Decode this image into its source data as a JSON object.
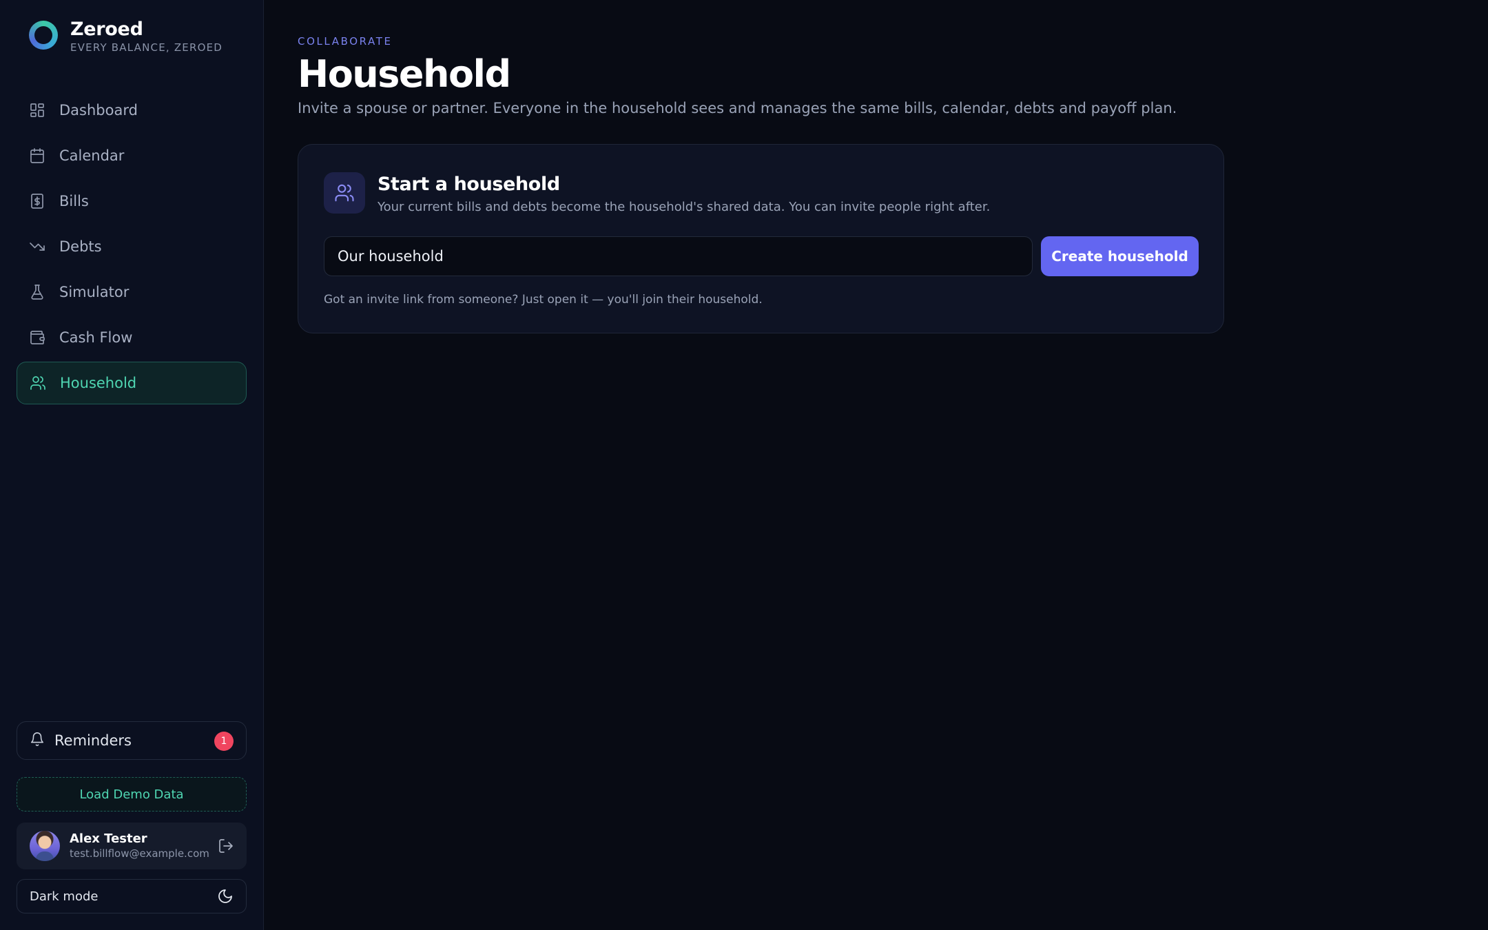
{
  "brand": {
    "name": "Zeroed",
    "tagline": "EVERY BALANCE, ZEROED"
  },
  "sidebar": {
    "items": [
      {
        "label": "Dashboard",
        "icon": "dashboard-icon",
        "active": false
      },
      {
        "label": "Calendar",
        "icon": "calendar-icon",
        "active": false
      },
      {
        "label": "Bills",
        "icon": "bills-icon",
        "active": false
      },
      {
        "label": "Debts",
        "icon": "trending-down-icon",
        "active": false
      },
      {
        "label": "Simulator",
        "icon": "flask-icon",
        "active": false
      },
      {
        "label": "Cash Flow",
        "icon": "wallet-icon",
        "active": false
      },
      {
        "label": "Household",
        "icon": "users-icon",
        "active": true
      }
    ],
    "reminders": {
      "label": "Reminders",
      "count": "1"
    },
    "demo_label": "Load Demo Data",
    "user": {
      "name": "Alex Tester",
      "email": "test.billflow@example.com"
    },
    "dark_mode_label": "Dark mode"
  },
  "main": {
    "eyebrow": "COLLABORATE",
    "title": "Household",
    "subtitle": "Invite a spouse or partner. Everyone in the household sees and manages the same bills, calendar, debts and payoff plan.",
    "card": {
      "title": "Start a household",
      "description": "Your current bills and debts become the household's shared data. You can invite people right after.",
      "input_value": "Our household",
      "button_label": "Create household",
      "hint": "Got an invite link from someone? Just open it — you'll join their household."
    }
  },
  "colors": {
    "accent": "#6366f1",
    "active_nav": "#4fd6b2",
    "badge": "#f0455f",
    "background": "#080b14"
  }
}
